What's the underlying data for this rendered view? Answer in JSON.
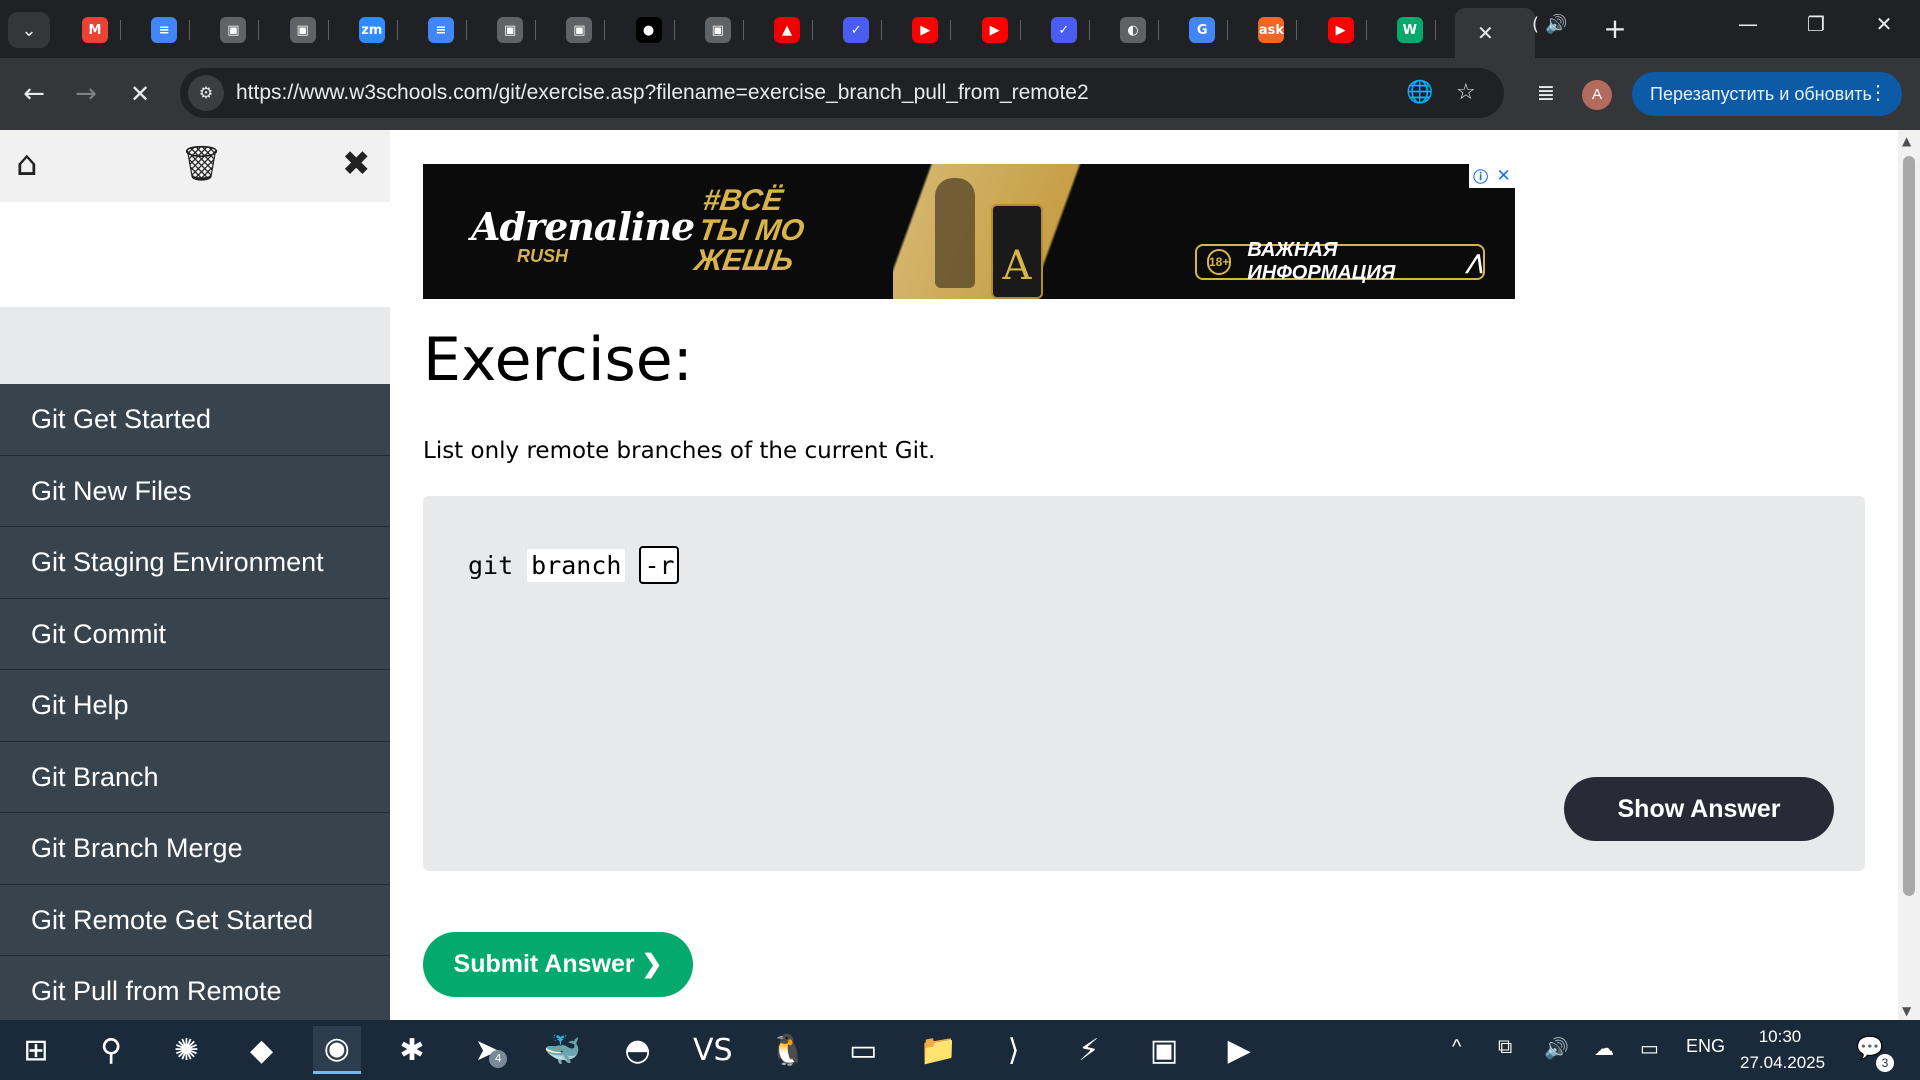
{
  "browser": {
    "tabs": [
      {
        "icon": "tab-search-icon",
        "glyph": "⌄"
      },
      {
        "icon": "gmail-icon",
        "glyph": "M",
        "color": "#ea4335"
      },
      {
        "icon": "google-docs-icon",
        "glyph": "≡",
        "color": "#4285f4"
      },
      {
        "icon": "contact-card-icon",
        "glyph": "▣",
        "color": "#5f6368"
      },
      {
        "icon": "contact-card-icon",
        "glyph": "▣",
        "color": "#5f6368"
      },
      {
        "icon": "zoom-icon",
        "glyph": "zm",
        "color": "#2d8cff"
      },
      {
        "icon": "google-docs-icon",
        "glyph": "≡",
        "color": "#4285f4"
      },
      {
        "icon": "contact-card-icon",
        "glyph": "▣",
        "color": "#5f6368"
      },
      {
        "icon": "contact-card-icon",
        "glyph": "▣",
        "color": "#5f6368"
      },
      {
        "icon": "github-icon",
        "glyph": "●",
        "color": "#000000"
      },
      {
        "icon": "contact-card-icon",
        "glyph": "▣",
        "color": "#5f6368"
      },
      {
        "icon": "redhat-icon",
        "glyph": "▲",
        "color": "#ee0000"
      },
      {
        "icon": "checkmark-bird-icon",
        "glyph": "✓",
        "color": "#4b5cf0"
      },
      {
        "icon": "youtube-icon",
        "glyph": "▶",
        "color": "#ff0000"
      },
      {
        "icon": "youtube-icon",
        "glyph": "▶",
        "color": "#ff0000"
      },
      {
        "icon": "checkmark-bird-icon",
        "glyph": "✓",
        "color": "#4b5cf0"
      },
      {
        "icon": "globe-icon",
        "glyph": "◐",
        "color": "#5f6368"
      },
      {
        "icon": "google-translate-icon",
        "glyph": "G",
        "color": "#4285f4"
      },
      {
        "icon": "ask-icon",
        "glyph": "ask",
        "color": "#f26522"
      },
      {
        "icon": "youtube-icon",
        "glyph": "▶",
        "color": "#ff0000"
      },
      {
        "icon": "w3schools-icon",
        "glyph": "W",
        "color": "#04aa6d"
      }
    ],
    "active_tab_close": "✕",
    "audio_tab_label": "(",
    "new_tab": "+",
    "url": "https://www.w3schools.com/git/exercise.asp?filename=exercise_branch_pull_from_remote2",
    "profile_initial": "A",
    "relaunch_label": "Перезапустить и обновить",
    "accent": "#0d5aa7"
  },
  "sidebar": {
    "items": [
      {
        "label": "Git Get Started"
      },
      {
        "label": "Git New Files"
      },
      {
        "label": "Git Staging Environment"
      },
      {
        "label": "Git Commit"
      },
      {
        "label": "Git Help"
      },
      {
        "label": "Git Branch"
      },
      {
        "label": "Git Branch Merge"
      },
      {
        "label": "Git Remote Get Started"
      },
      {
        "label": "Git Pull from Remote"
      }
    ]
  },
  "ad": {
    "brand": "Adrenaline",
    "brand_sub": "RUSH",
    "slogan": "#ВСЁ ТЫ МО ЖЕШЬ",
    "age": "18+",
    "info": "ВАЖНАЯ ИНФОРМАЦИЯ",
    "info_arrow": "⋀",
    "can_letter": "A"
  },
  "main": {
    "heading": "Exercise:",
    "instruction": "List only remote branches of the current Git.",
    "code": {
      "cmd": "git",
      "subcmd": "branch",
      "input_value": "-r"
    },
    "show_answer": "Show Answer",
    "submit": "Submit Answer ❯"
  },
  "taskbar": {
    "apps": [
      {
        "name": "start-button",
        "glyph": "⊞"
      },
      {
        "name": "search-icon",
        "glyph": "⚲"
      },
      {
        "name": "chatgpt-icon",
        "glyph": "✺"
      },
      {
        "name": "copilot-icon",
        "glyph": "◆"
      },
      {
        "name": "chrome-icon",
        "glyph": "◉",
        "active": true
      },
      {
        "name": "app-red-icon",
        "glyph": "✱"
      },
      {
        "name": "telegram-icon",
        "glyph": "➤",
        "badge": "4"
      },
      {
        "name": "docker-icon",
        "glyph": "🐳"
      },
      {
        "name": "edge-icon",
        "glyph": "◓"
      },
      {
        "name": "visual-studio-icon",
        "glyph": "VS"
      },
      {
        "name": "penguin-icon",
        "glyph": "🐧"
      },
      {
        "name": "terminal-icon",
        "glyph": "▭"
      },
      {
        "name": "file-explorer-icon",
        "glyph": "📁"
      },
      {
        "name": "vscode-icon",
        "glyph": "⟩"
      },
      {
        "name": "x64-tool-icon",
        "glyph": "⚡"
      },
      {
        "name": "remote-terminal-icon",
        "glyph": "▣"
      },
      {
        "name": "media-player-icon",
        "glyph": "▶"
      }
    ],
    "tray": {
      "chevron": "^",
      "lang": "ENG",
      "time": "10:30",
      "date": "27.04.2025",
      "notifications": "3"
    }
  }
}
